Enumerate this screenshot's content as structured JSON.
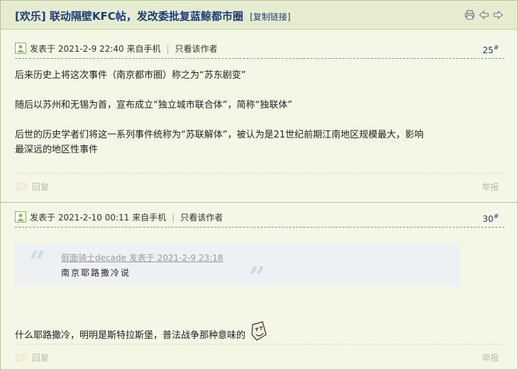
{
  "thread": {
    "title": "[欢乐] 联动隔壁KFC帖，发改委批复蓝鲸都市圈",
    "copy_link": "[复制链接]"
  },
  "toolbar": {
    "icons": [
      "print-icon",
      "prev-icon",
      "next-icon"
    ]
  },
  "posts": [
    {
      "meta": "发表于 2021-2-9 22:40 来自手机",
      "author_only": "只看该作者",
      "floor": "25",
      "floor_mark": "#",
      "paragraphs": [
        "后来历史上将这次事件（南京都市圈）称之为“苏东剧变”",
        "随后以苏州和无锡为首，宣布成立“独立城市联合体”，简称“独联体”",
        "后世的历史学者们将这一系列事件统称为“苏联解体”，被认为是21世纪前期江南地区规模最大，影响",
        "最深远的地区性事件"
      ],
      "reply": "回复",
      "report": "举报"
    },
    {
      "meta": "发表于 2021-2-10 00:11 来自手机",
      "author_only": "只看该作者",
      "floor": "30",
      "floor_mark": "#",
      "quote": {
        "open_mark": "“",
        "close_mark": "”",
        "header": "假面骑士decade 发表于 2021-2-9 23:18",
        "body": "南京耶路撒冷说"
      },
      "text": "什么耶路撒冷，明明是斯特拉斯堡，普法战争那种意味的",
      "reply": "回复",
      "report": "举报"
    }
  ],
  "colors": {
    "accent": "#1f3c7a",
    "background": "#f4f6e6",
    "titlebar": "#e6ecd0"
  }
}
